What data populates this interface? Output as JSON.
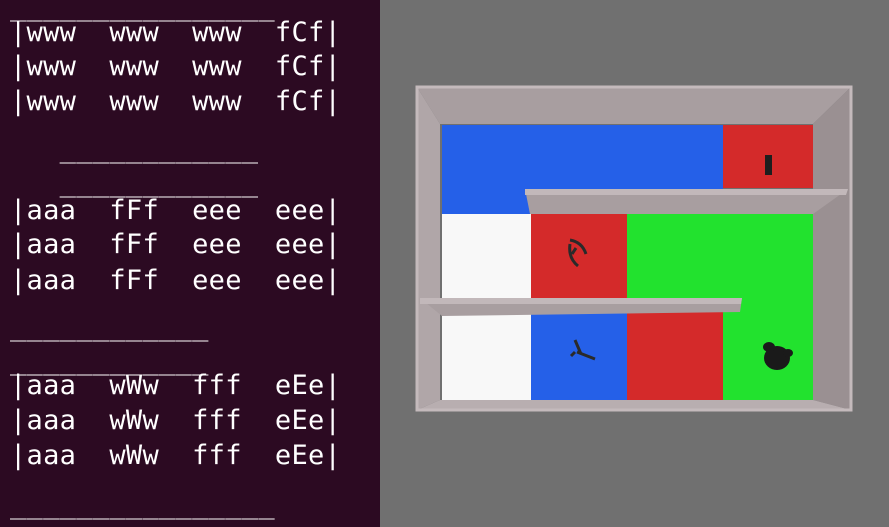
{
  "terminal": {
    "lines": [
      "________________",
      "|www  www  www  fCf|",
      "|www  www  www  fCf|",
      "|www  www  www  fCf|",
      "",
      "   ____________",
      "   ____________",
      "|aaa  fFf  eee  eee|",
      "|aaa  fFf  eee  eee|",
      "|aaa  fFf  eee  eee|",
      "",
      "____________",
      "____________",
      "|aaa  wWw  fff  eEe|",
      "|aaa  wWw  fff  eEe|",
      "|aaa  wWw  fff  eEe|",
      "",
      "________________"
    ]
  },
  "scene": {
    "colors": {
      "wall": "#a89ea0",
      "wall_dark": "#8c8284",
      "floor_outer": "#bdb3b5",
      "blue": "#2560e8",
      "red": "#d42a2a",
      "green": "#22e22e",
      "white": "#f8f8f8"
    },
    "agents": [
      {
        "name": "agent-arrow-red-cell",
        "icon": "arrow-agent-icon"
      },
      {
        "name": "agent-arrow-blue-cell",
        "icon": "arrow-agent-icon"
      },
      {
        "name": "agent-blob-green-cell",
        "icon": "blob-agent-icon"
      },
      {
        "name": "agent-door-red-cell",
        "icon": "door-marker-icon"
      }
    ]
  }
}
